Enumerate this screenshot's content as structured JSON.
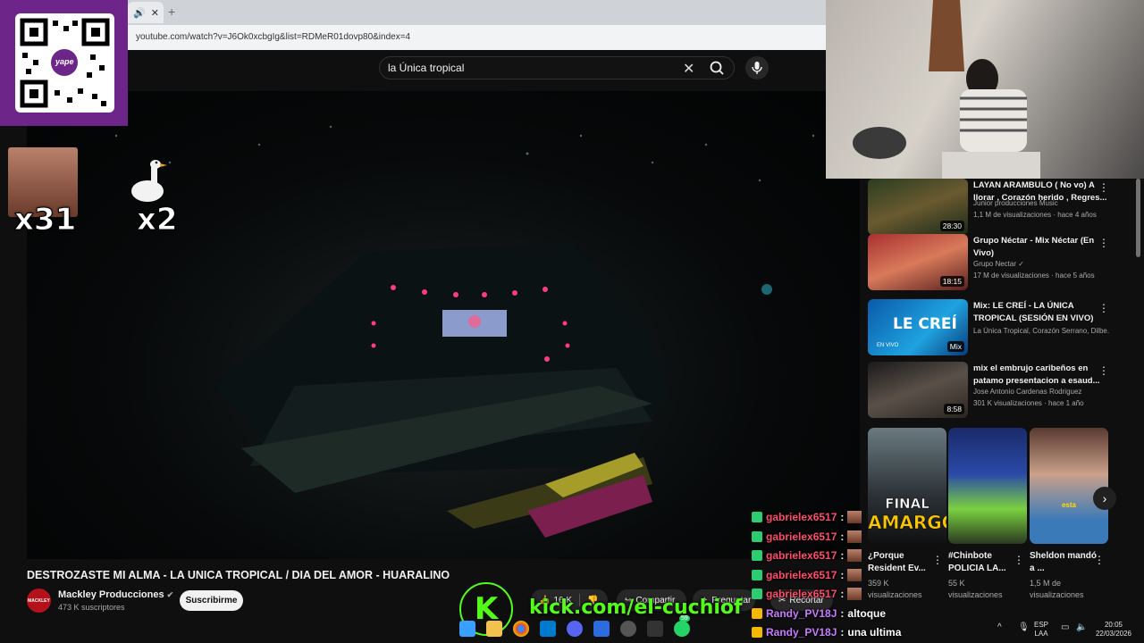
{
  "browser": {
    "tab_close": "✕",
    "new_tab": "+",
    "url": "youtube.com/watch?v=J6Ok0xcbgIg&list=RDMeR01dovp80&index=4"
  },
  "header": {
    "search_value": "la Única tropical"
  },
  "overlay": {
    "emote_count_1": "x31",
    "emote_count_2": "x2",
    "qr_brand": "yape",
    "kick_logo": "K",
    "kick_url": "kick.com/el-cuchiof"
  },
  "video": {
    "title": "DESTROZASTE MI ALMA - LA UNICA TROPICAL / DIA DEL AMOR - HUARALINO",
    "channel": "Mackley Producciones",
    "channel_avatar_text": "MACKLEY",
    "subscribers": "473 K suscriptores",
    "subscribe_label": "Suscribirme",
    "likes": "16 K",
    "share_label": "Compartir",
    "ask_label": "Preguntar",
    "clip_label": "Recortar"
  },
  "sidebar": {
    "items": [
      {
        "title": "LAYAN ARAMBULO ( No vo) A llorar , Corazón herido , Regres...",
        "channel": "Junior producciones Music",
        "meta": "1,1 M de visualizaciones · hace 4 años",
        "duration": "28:30"
      },
      {
        "title": "Grupo Néctar - Mix Néctar (En Vivo)",
        "channel": "Grupo Nectar ✓",
        "meta": "17 M de visualizaciones · hace 5 años",
        "duration": "18:15"
      },
      {
        "title": "Mix: LE CREÍ - LA ÚNICA TROPICAL (SESIÓN EN VIVO)",
        "channel": "La Única Tropical, Corazón Serrano, Dilbe...",
        "meta": "",
        "duration": "Mix",
        "thumb_text": "LE CREÍ",
        "thumb_sub": "EN VIVO"
      },
      {
        "title": "mix el embrujo caribeños en patamo presentacion a esaud...",
        "channel": "Jose Antonio Cardenas Rodriguez",
        "meta": "301 K visualizaciones · hace 1 año",
        "duration": "8:58"
      }
    ]
  },
  "shorts": [
    {
      "title": "¿Porque Resident Ev...",
      "views": "359 K",
      "views_label": "visualizaciones",
      "thumb_text_1": "FINAL",
      "thumb_text_2": "AMARGO"
    },
    {
      "title": "#Chinbote POLICIA LA...",
      "views": "55 K",
      "views_label": "visualizaciones"
    },
    {
      "title": "Sheldon mandó a ...",
      "views": "1,5 M de",
      "views_label": "visualizaciones",
      "thumb_text_1": "esta"
    }
  ],
  "chat": [
    {
      "user": "gabrielex6517",
      "sep": " :",
      "msg": "",
      "color": "#ff4d6d",
      "emote": true
    },
    {
      "user": "gabrielex6517",
      "sep": " :",
      "msg": "",
      "color": "#ff4d6d",
      "emote": true
    },
    {
      "user": "gabrielex6517",
      "sep": " :",
      "msg": "",
      "color": "#ff4d6d",
      "emote": true
    },
    {
      "user": "gabrielex6517",
      "sep": " :",
      "msg": "",
      "color": "#ff4d6d",
      "emote": true
    },
    {
      "user": "gabrielex6517",
      "sep": " :",
      "msg": "",
      "color": "#ff4d6d",
      "emote": true
    },
    {
      "user": "Randy_PV18J",
      "sep": " :",
      "msg": " altoque",
      "color": "#c97bff",
      "emote": false
    },
    {
      "user": "Randy_PV18J",
      "sep": " :",
      "msg": " una ultima",
      "color": "#c97bff",
      "emote": false
    }
  ],
  "taskbar": {
    "badge_count": "59",
    "lang_1": "ESP",
    "lang_2": "LAA",
    "time": "20:05",
    "date": "22/03/2026"
  },
  "colors": {
    "kick_green": "#53fc18",
    "yape_purple": "#6e2589",
    "chat_red": "#ff4d6d",
    "chat_purple": "#c97bff"
  }
}
